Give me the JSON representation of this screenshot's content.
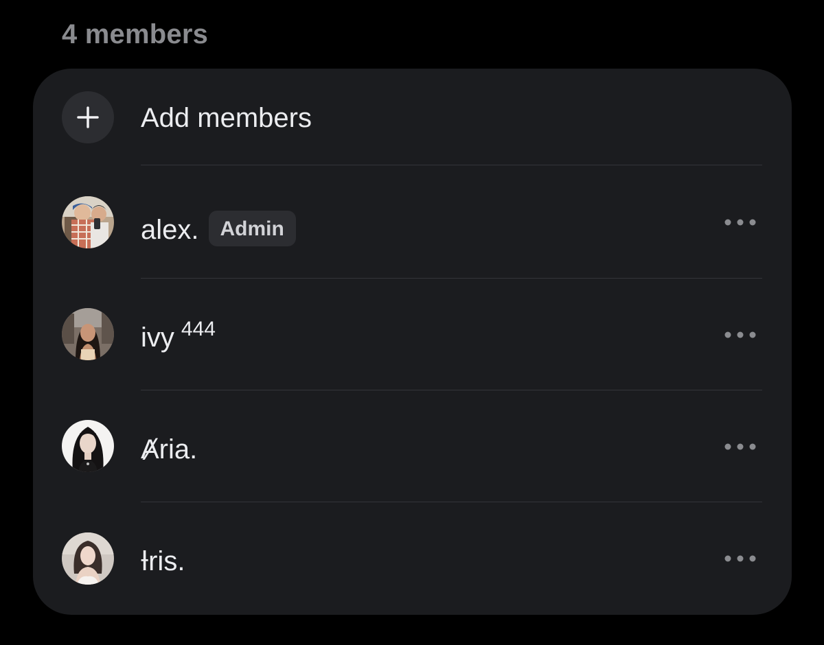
{
  "section": {
    "members_count": "4 members"
  },
  "add_members": {
    "label": "Add members",
    "icon": "plus-icon"
  },
  "members": [
    {
      "name": "alex.",
      "suffix": "",
      "badge": "Admin",
      "more_icon": "ellipsis-icon"
    },
    {
      "name": "ivy",
      "suffix": "444",
      "badge": "",
      "more_icon": "ellipsis-icon"
    },
    {
      "name": "Ⱥria.",
      "suffix": "",
      "badge": "",
      "more_icon": "ellipsis-icon"
    },
    {
      "name": "Ɨris.",
      "suffix": "",
      "badge": "",
      "more_icon": "ellipsis-icon"
    }
  ],
  "colors": {
    "background": "#000000",
    "card": "#1b1c1f",
    "badge_bg": "#2c2d31",
    "text_primary": "#ecedf0",
    "text_secondary": "#8a8b8f",
    "divider": "#34353a"
  }
}
